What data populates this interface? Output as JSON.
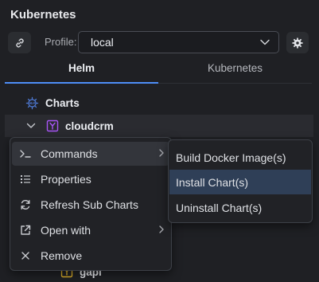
{
  "panel": {
    "title": "Kubernetes"
  },
  "profile": {
    "label": "Profile:",
    "value": "local"
  },
  "tabs": [
    {
      "label": "Helm",
      "active": true
    },
    {
      "label": "Kubernetes",
      "active": false
    }
  ],
  "tree": {
    "charts_label": "Charts",
    "chart_name": "cloudcrm",
    "partial_child": "gapi"
  },
  "context_menu": {
    "items": [
      {
        "label": "Commands",
        "icon": "terminal-icon",
        "has_submenu": true
      },
      {
        "label": "Properties",
        "icon": "list-icon",
        "has_submenu": false
      },
      {
        "label": "Refresh Sub Charts",
        "icon": "refresh-icon",
        "has_submenu": false
      },
      {
        "label": "Open with",
        "icon": "external-link-icon",
        "has_submenu": true
      },
      {
        "label": "Remove",
        "icon": "close-icon",
        "has_submenu": false
      }
    ]
  },
  "submenu": {
    "items": [
      {
        "label": "Build Docker Image(s)"
      },
      {
        "label": "Install Chart(s)"
      },
      {
        "label": "Uninstall Chart(s)"
      }
    ]
  },
  "colors": {
    "background": "#1f2024",
    "accent": "#4e8ef7",
    "helm_icon": "#4f7bd6",
    "chart_icon": "#a855f7",
    "folder_icon": "#e0b12a",
    "hover": "#2f3f57"
  }
}
